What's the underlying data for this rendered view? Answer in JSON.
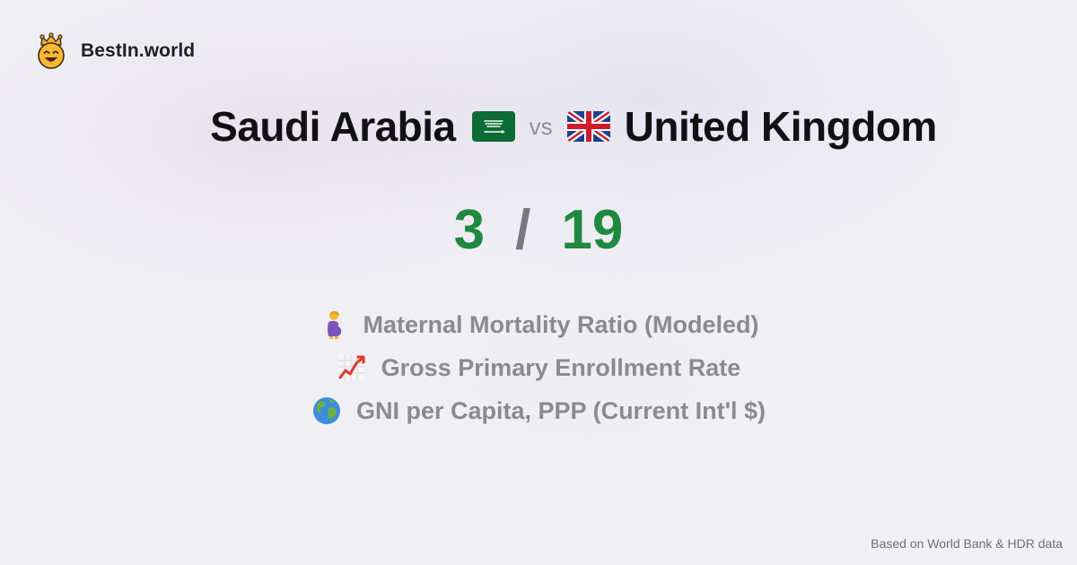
{
  "brand": {
    "name": "BestIn.world",
    "logo_icon": "crowned-smiley-icon"
  },
  "comparison": {
    "left_country": "Saudi Arabia",
    "left_flag_icon": "saudi-arabia-flag-icon",
    "vs_label": "vs",
    "right_country": "United Kingdom",
    "right_flag_icon": "united-kingdom-flag-icon"
  },
  "score": {
    "left": "3",
    "separator": "/",
    "right": "19",
    "color": "#1f8a3f"
  },
  "metrics": [
    {
      "icon": "pregnant-woman-icon",
      "label": "Maternal Mortality Ratio (Modeled)"
    },
    {
      "icon": "chart-increasing-icon",
      "label": "Gross Primary Enrollment Rate"
    },
    {
      "icon": "globe-icon",
      "label": "GNI per Capita, PPP (Current Int'l $)"
    }
  ],
  "footer": {
    "source_note": "Based on World Bank & HDR data"
  }
}
